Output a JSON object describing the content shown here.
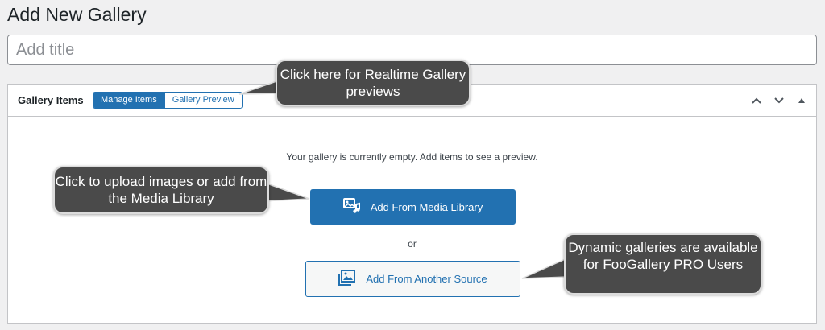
{
  "page": {
    "title": "Add New Gallery",
    "title_input_placeholder": "Add title"
  },
  "panel": {
    "title": "Gallery Items",
    "tabs": [
      {
        "label": "Manage Items",
        "active": true
      },
      {
        "label": "Gallery Preview",
        "active": false
      }
    ],
    "controls": [
      "chevron-up-icon",
      "chevron-down-icon",
      "triangle-up-icon"
    ],
    "empty_message": "Your gallery is currently empty. Add items to see a preview.",
    "add_media_label": "Add From Media Library",
    "add_media_icon": "media-library-icon",
    "or_text": "or",
    "add_source_label": "Add From Another Source",
    "add_source_icon": "gallery-icon"
  },
  "callouts": {
    "preview": "Click here for Realtime Gallery previews",
    "upload": "Click to upload images or add from the Media Library",
    "dynamic": "Dynamic galleries are available for FooGallery PRO Users"
  },
  "colors": {
    "primary": "#2271b1",
    "callout_bg": "#4a4a4a",
    "page_bg": "#f0f0f1"
  }
}
